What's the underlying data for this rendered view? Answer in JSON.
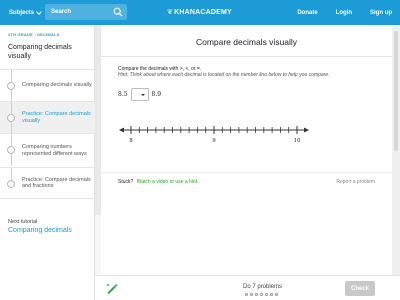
{
  "nav": {
    "subjects_label": "Subjects",
    "search_placeholder": "Search",
    "logo_text": "KHANACADEMY",
    "donate": "Donate",
    "login": "Login",
    "signup": "Sign up",
    "brand_color": "#1c9bd6"
  },
  "sidebar": {
    "breadcrumb": "4TH GRADE  › DECIMALS",
    "title": "Comparing decimals visually",
    "steps": [
      {
        "label": "Comparing decimals visually",
        "active": false
      },
      {
        "label": "Practice: Compare decimals visually",
        "active": true
      },
      {
        "label": "Comparing numbers represented different ways",
        "active": false
      },
      {
        "label": "Practice: Compare decimals and fractions",
        "active": false
      }
    ],
    "next_label": "Next tutorial",
    "next_link": "Comparing decimals"
  },
  "main": {
    "title": "Compare decimals visually",
    "prompt": "Compare the decimals with >, <, or =.",
    "hint": "Hint: Think about where each decimal is located on the number line below to help you compare.",
    "left_value": "8.5",
    "right_value": "8.9",
    "numberline": {
      "min": 8,
      "max": 10,
      "step": 0.1,
      "labels": [
        "8",
        "9",
        "10"
      ]
    },
    "stuck_label": "Stuck?",
    "stuck_link": "Watch a video or use a hint.",
    "report_label": "Report a problem"
  },
  "footer": {
    "do_label": "Do 7 problems",
    "problem_count": 7,
    "check_label": "Check"
  }
}
